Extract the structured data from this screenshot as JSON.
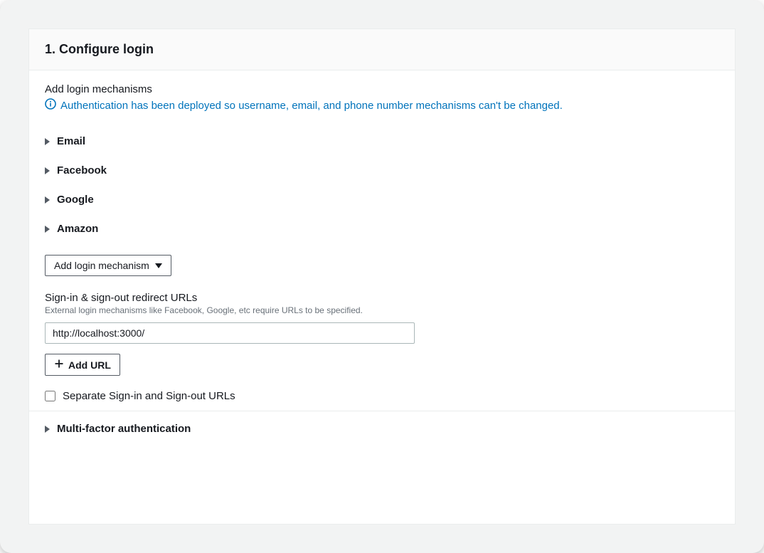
{
  "header": {
    "title": "1. Configure login"
  },
  "loginMechanisms": {
    "label": "Add login mechanisms",
    "notice": "Authentication has been deployed so username, email, and phone number mechanisms can't be changed.",
    "items": [
      {
        "label": "Email"
      },
      {
        "label": "Facebook"
      },
      {
        "label": "Google"
      },
      {
        "label": "Amazon"
      }
    ],
    "addButtonLabel": "Add login mechanism"
  },
  "redirectUrls": {
    "label": "Sign-in & sign-out redirect URLs",
    "help": "External login mechanisms like Facebook, Google, etc require URLs to be specified.",
    "value": "http://localhost:3000/",
    "addUrlLabel": "Add URL",
    "separateCheckboxLabel": "Separate Sign-in and Sign-out URLs",
    "separateChecked": false
  },
  "mfa": {
    "label": "Multi-factor authentication"
  }
}
